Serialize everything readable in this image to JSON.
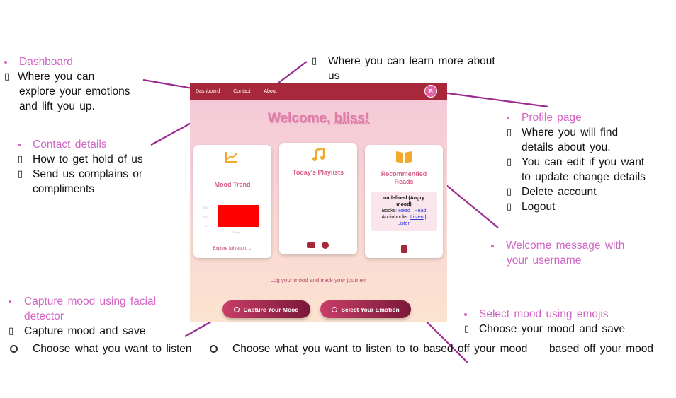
{
  "annotations": {
    "dashboard": {
      "title": "Dashboard",
      "lines": [
        "Where you can",
        "explore your emotions",
        "and lift you up."
      ]
    },
    "about": {
      "lines": [
        "Where you can learn more about",
        "us"
      ]
    },
    "contact": {
      "title": "Contact details",
      "items": [
        "How to get hold of us",
        "Send us complains or",
        "compliments"
      ]
    },
    "profile": {
      "title": "Profile page",
      "items": [
        "Where you will find",
        "details about you.",
        "You can edit if you want",
        "to update change details",
        "Delete account",
        "Logout"
      ]
    },
    "welcome": {
      "title": "Welcome message with",
      "title2": "your username"
    },
    "capture": {
      "title": "Capture mood using facial",
      "title2": "detector",
      "item": "Capture mood and save"
    },
    "select": {
      "title": "Select mood using emojis",
      "item": "Choose your mood and save"
    },
    "options": [
      "Choose what you want to listen",
      "Choose what you want to listen to to based off your mood",
      "based off your mood"
    ]
  },
  "app": {
    "nav": [
      "Dashboard",
      "Contact",
      "About"
    ],
    "avatar": "B",
    "welcome_prefix": "Welcome, ",
    "welcome_user": "bliss!",
    "cards": {
      "mood": {
        "title": "Mood Trend",
        "link": "Explore full report →",
        "ticks": [
          "0.8",
          "0.5",
          "0"
        ],
        "xlabel": "Today"
      },
      "playlists": {
        "title": "Today's Playlists"
      },
      "reads": {
        "title1": "Recommended",
        "title2": "Reads",
        "mood": "undefined (Angry",
        "mood2": "mood)",
        "books_label": "Books:",
        "read1": "Read",
        "read2": "Read",
        "audio_label": "Audiobooks:",
        "listen1": "Listen",
        "listen2": "Listen"
      }
    },
    "note": "Log your mood and track your journey.",
    "buttons": {
      "capture": "Capture Your Mood",
      "select": "Select Your Emotion"
    }
  },
  "colors": {
    "nav": "#a6283a",
    "accent": "#d264c4",
    "button": "#c83e68"
  }
}
